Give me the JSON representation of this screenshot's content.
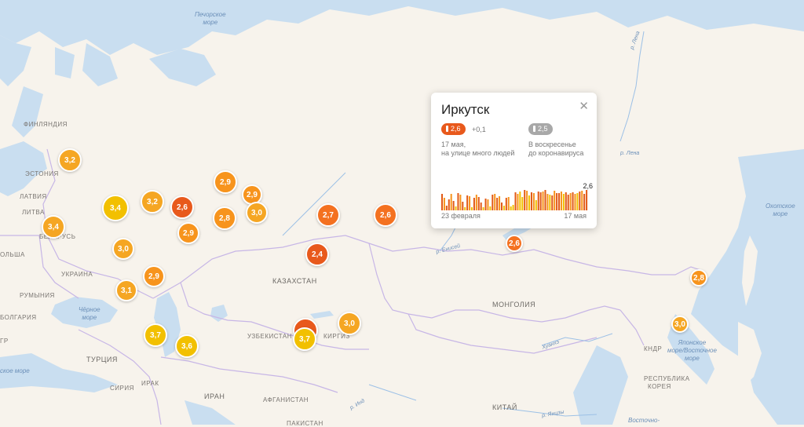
{
  "popup": {
    "city": "Иркутск",
    "current_value": "2,6",
    "delta": "+0,1",
    "current_caption_line1": "17 мая,",
    "current_caption_line2": "на улице много людей",
    "baseline_value": "2,5",
    "baseline_caption_line1": "В воскресенье",
    "baseline_caption_line2": "до коронавируса",
    "chart_last_label": "2,6",
    "chart_start_label": "23 февраля",
    "chart_end_label": "17 мая",
    "close_symbol": "✕"
  },
  "colors": {
    "high": "#f2c000",
    "mid_high": "#f5a623",
    "mid": "#f7941d",
    "low": "#f47120",
    "lowest": "#e8591c",
    "baseline_pill": "#a8a8a8",
    "bar_dark": "#e25a17",
    "bar_orange": "#f7941d",
    "bar_yellow": "#f2c000"
  },
  "markers": [
    {
      "value": "3,2",
      "tone": "mid_high"
    },
    {
      "value": "3,4",
      "tone": "high"
    },
    {
      "value": "3,4",
      "tone": "mid_high"
    },
    {
      "value": "3,2",
      "tone": "mid_high"
    },
    {
      "value": "2,6",
      "tone": "lowest"
    },
    {
      "value": "2,9",
      "tone": "mid"
    },
    {
      "value": "2,9",
      "tone": "mid"
    },
    {
      "value": "3,0",
      "tone": "mid_high"
    },
    {
      "value": "2,8",
      "tone": "mid"
    },
    {
      "value": "2,9",
      "tone": "mid"
    },
    {
      "value": "2,7",
      "tone": "low"
    },
    {
      "value": "2,6",
      "tone": "low"
    },
    {
      "value": "3,0",
      "tone": "mid_high"
    },
    {
      "value": "2,9",
      "tone": "mid"
    },
    {
      "value": "3,1",
      "tone": "mid_high"
    },
    {
      "value": "2,4",
      "tone": "lowest"
    },
    {
      "value": "3,7",
      "tone": "high"
    },
    {
      "value": "3,6",
      "tone": "high"
    },
    {
      "value": "3,0",
      "tone": "mid_high"
    },
    {
      "value": "3,7",
      "tone": "high"
    },
    {
      "value": "2,6",
      "tone": "low"
    },
    {
      "value": "2,8",
      "tone": "mid"
    },
    {
      "value": "3,0",
      "tone": "mid_high"
    }
  ],
  "labels": {
    "finland": "ФИНЛЯНДИЯ",
    "estonia": "ЭСТОНИЯ",
    "latvia": "ЛАТВИЯ",
    "lithuania": "ЛИТВА",
    "belarus": "БЕЛАРУСЬ",
    "poland": "ОЛЬША",
    "ukraine": "УКРАИНА",
    "romania": "РУМЫНИЯ",
    "bulgaria": "БОЛГАРИЯ",
    "turkey": "ТУРЦИЯ",
    "syria": "СИРИЯ",
    "iraq": "ИРАК",
    "iran": "ИРАН",
    "kazakhstan": "КАЗАХСТАН",
    "uzbekistan": "УЗБЕКИСТАН",
    "kyrgyzstan": "КИРГИЗ",
    "afghanistan": "АФГАНИСТАН",
    "pakistan": "ПАКИСТАН",
    "mongolia": "МОНГОЛИЯ",
    "china": "КИТАЙ",
    "korea1": "КНДР",
    "korea2": "РЕСПУБЛИКА",
    "korea3": "КОРЕЯ",
    "greece": "ГР",
    "pechora_sea1": "Печорское",
    "pechora_sea2": "море",
    "black_sea1": "Чёрное",
    "black_sea2": "море",
    "okhotsk_sea1": "Охотское",
    "okhotsk_sea2": "море",
    "japan_sea1": "Японское",
    "japan_sea2": "море/Восточное",
    "japan_sea3": "море",
    "east_sea": "Восточно-",
    "river_lena1": "р. Лена",
    "river_lena2": "р. Лена",
    "river_yenisei": "р. Енисей",
    "river_huanghe": "Хуанхэ",
    "river_yangtze": "р. Янцзы",
    "river_ind": "р. Инд",
    "mediterranean": "ское море"
  },
  "chart_data": {
    "type": "bar",
    "title": "",
    "x_start": "23 февраля",
    "x_end": "17 мая",
    "last_value_label": "2,6",
    "values": [
      2.1,
      1.6,
      0.6,
      1.4,
      2.1,
      1.2,
      0.5,
      2.2,
      2.0,
      1.1,
      0.4,
      1.9,
      1.8,
      0.4,
      1.6,
      2.0,
      1.7,
      1.0,
      0.4,
      1.5,
      1.4,
      0.5,
      2.0,
      2.1,
      1.6,
      1.8,
      1.0,
      0.6,
      1.6,
      1.7,
      0.5,
      0.7,
      2.3,
      2.1,
      2.4,
      1.7,
      2.6,
      2.5,
      1.9,
      2.3,
      2.2,
      1.3,
      2.4,
      2.3,
      2.4,
      2.6,
      2.1,
      2.0,
      1.9,
      2.5,
      2.2,
      2.2,
      2.4,
      2.1,
      2.3,
      2.0,
      2.2,
      2.3,
      2.1,
      2.2,
      2.4,
      2.5,
      2.1,
      2.6
    ],
    "tones": [
      "d",
      "o",
      "d",
      "d",
      "o",
      "d",
      "y",
      "d",
      "o",
      "d",
      "y",
      "d",
      "o",
      "y",
      "d",
      "o",
      "d",
      "d",
      "y",
      "d",
      "o",
      "y",
      "d",
      "o",
      "d",
      "o",
      "d",
      "y",
      "d",
      "o",
      "y",
      "y",
      "d",
      "o",
      "y",
      "y",
      "d",
      "o",
      "y",
      "d",
      "o",
      "y",
      "d",
      "d",
      "o",
      "d",
      "o",
      "y",
      "d",
      "o",
      "d",
      "d",
      "o",
      "y",
      "d",
      "d",
      "o",
      "d",
      "o",
      "y",
      "d",
      "o",
      "d",
      "d"
    ]
  }
}
